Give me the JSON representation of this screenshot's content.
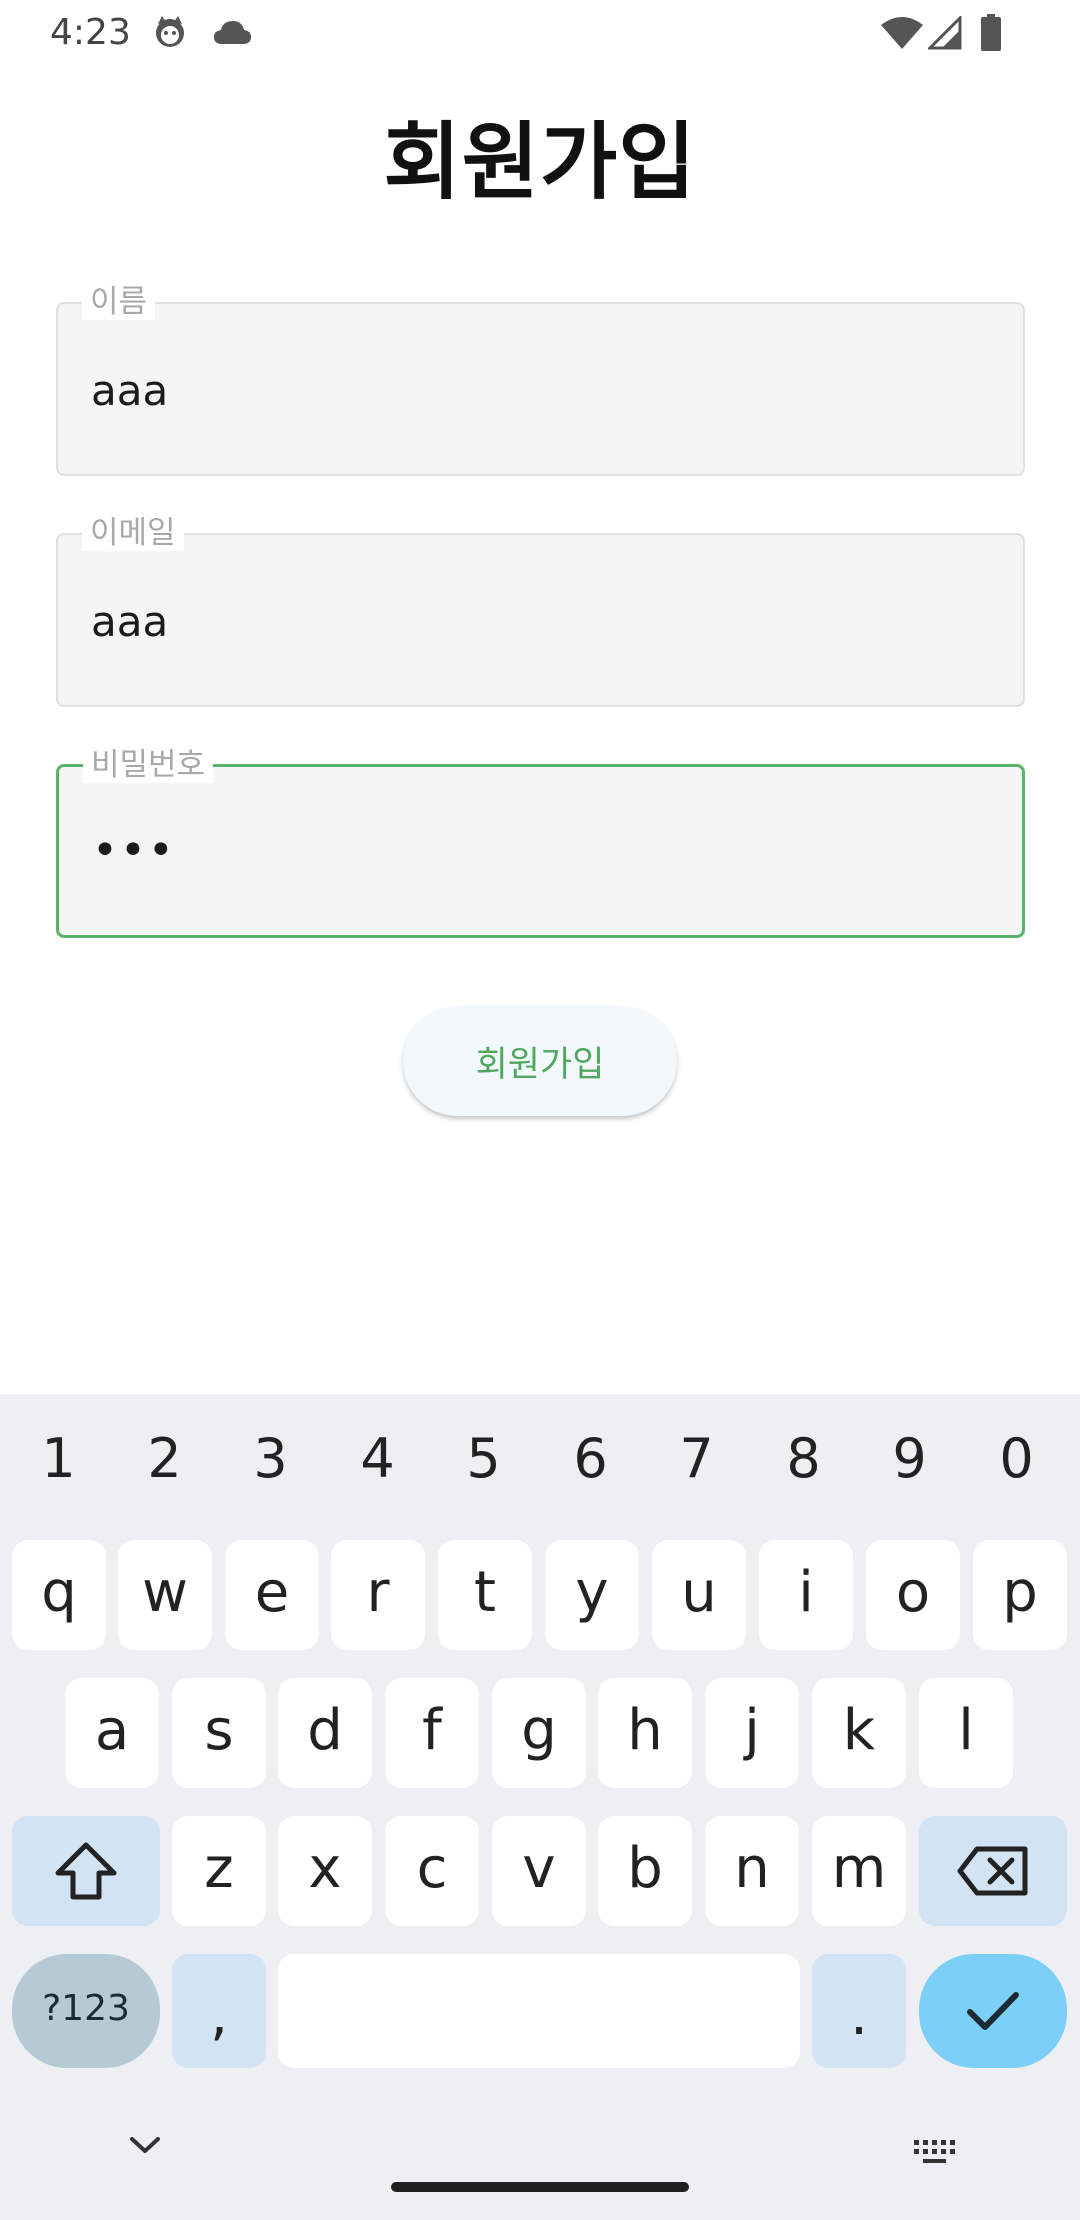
{
  "status_bar": {
    "time": "4:23",
    "icons": [
      "cat-notification-icon",
      "cloud-icon",
      "wifi-icon",
      "signal-icon",
      "battery-icon"
    ]
  },
  "page": {
    "title": "회원가입"
  },
  "form": {
    "name": {
      "label": "이름",
      "value": "aaa"
    },
    "email": {
      "label": "이메일",
      "value": "aaa"
    },
    "password": {
      "label": "비밀번호",
      "value": "•••"
    }
  },
  "signup_button": {
    "label": "회원가입"
  },
  "colors": {
    "accent": "#5ab46a",
    "button_text": "#4fa860",
    "keyboard_bg": "#eeeff2",
    "modifier_key": "#d2e3f3",
    "done_key": "#7ccff6"
  },
  "keyboard": {
    "numbers": [
      "1",
      "2",
      "3",
      "4",
      "5",
      "6",
      "7",
      "8",
      "9",
      "0"
    ],
    "row1": [
      "q",
      "w",
      "e",
      "r",
      "t",
      "y",
      "u",
      "i",
      "o",
      "p"
    ],
    "row2": [
      "a",
      "s",
      "d",
      "f",
      "g",
      "h",
      "j",
      "k",
      "l"
    ],
    "row3": [
      "z",
      "x",
      "c",
      "v",
      "b",
      "n",
      "m"
    ],
    "symbols_label": "?123",
    "comma": ",",
    "period": "."
  }
}
